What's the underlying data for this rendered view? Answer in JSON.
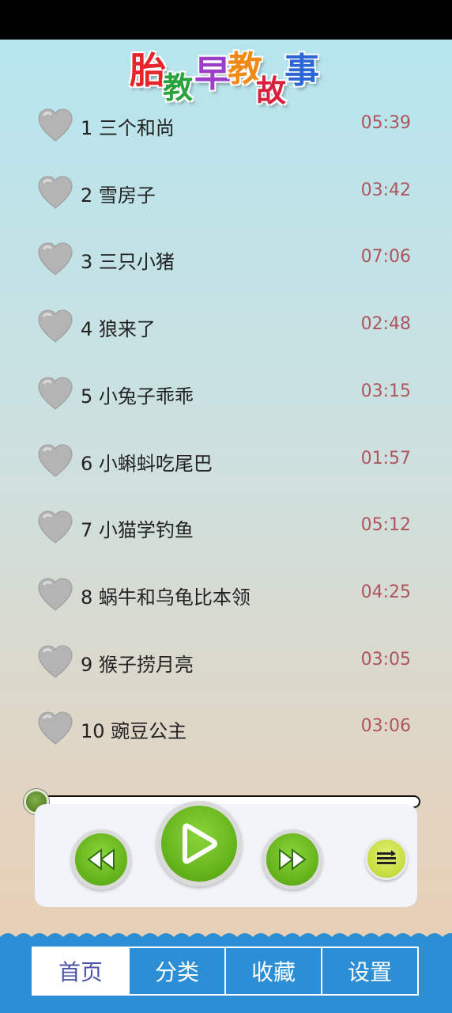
{
  "app": {
    "title_chars": [
      {
        "ch": "胎",
        "color": "#e8242b"
      },
      {
        "ch": "教",
        "color": "#2aa33c"
      },
      {
        "ch": "早",
        "color": "#9b3fc8"
      },
      {
        "ch": "教",
        "color": "#f08a14"
      },
      {
        "ch": "故",
        "color": "#d81f3c"
      },
      {
        "ch": "事",
        "color": "#2a66d6"
      }
    ]
  },
  "stories": [
    {
      "label": "1 三个和尚",
      "duration": "05:39",
      "favorite": false
    },
    {
      "label": "2 雪房子",
      "duration": "03:42",
      "favorite": false
    },
    {
      "label": "3 三只小猪",
      "duration": "07:06",
      "favorite": false
    },
    {
      "label": "4 狼来了",
      "duration": "02:48",
      "favorite": false
    },
    {
      "label": "5 小兔子乖乖",
      "duration": "03:15",
      "favorite": false
    },
    {
      "label": "6 小蝌蚪吃尾巴",
      "duration": "01:57",
      "favorite": false
    },
    {
      "label": "7 小猫学钓鱼",
      "duration": "05:12",
      "favorite": false
    },
    {
      "label": "8 蜗牛和乌龟比本领",
      "duration": "04:25",
      "favorite": false
    },
    {
      "label": "9 猴子捞月亮",
      "duration": "03:05",
      "favorite": false
    },
    {
      "label": "10 豌豆公主",
      "duration": "03:06",
      "favorite": false
    }
  ],
  "player": {
    "progress": 0,
    "accent": "#62b019"
  },
  "tabs": [
    {
      "label": "首页",
      "active": true
    },
    {
      "label": "分类",
      "active": false
    },
    {
      "label": "收藏",
      "active": false
    },
    {
      "label": "设置",
      "active": false
    }
  ],
  "colors": {
    "tabbar": "#2c8fd5",
    "duration_text": "#b0545e",
    "heart": "#b4b4b4"
  }
}
